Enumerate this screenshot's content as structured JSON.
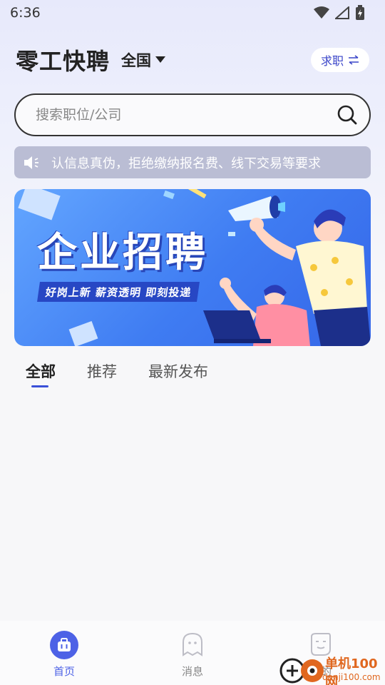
{
  "status_bar": {
    "time": "6:36"
  },
  "header": {
    "app_title": "零工快聘",
    "region": "全国",
    "mode_toggle": "求职"
  },
  "search": {
    "placeholder": "搜索职位/公司"
  },
  "notice": {
    "text": "认信息真伪，拒绝缴纳报名费、线下交易等要求"
  },
  "banner": {
    "title": "企业招聘",
    "subtitle": "好岗上新  薪资透明  即刻投递"
  },
  "tabs": [
    {
      "label": "全部",
      "active": true
    },
    {
      "label": "推荐",
      "active": false
    },
    {
      "label": "最新发布",
      "active": false
    }
  ],
  "bottom_nav": [
    {
      "label": "首页",
      "icon": "briefcase-icon",
      "active": true
    },
    {
      "label": "消息",
      "icon": "chat-ghost-icon",
      "active": false
    },
    {
      "label": "我的",
      "icon": "profile-face-icon",
      "active": false
    }
  ],
  "watermark": {
    "brand": "单机100网",
    "url": "danji100.com"
  },
  "colors": {
    "accent": "#4d62e6",
    "banner_blue": "#3f7cf2",
    "notice_bg": "#babdd4",
    "watermark_orange": "#e0671f"
  }
}
